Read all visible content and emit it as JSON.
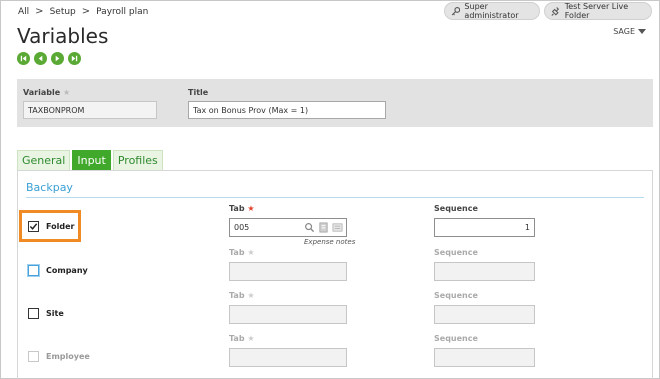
{
  "breadcrumb": {
    "items": [
      "All",
      "Setup",
      "Payroll plan"
    ],
    "separator": ">"
  },
  "top_buttons": {
    "user": {
      "label": "Super administrator",
      "icon": "key-icon"
    },
    "folder": {
      "label": "Test Server Live Folder",
      "icon": "plug-icon"
    }
  },
  "page": {
    "title": "Variables",
    "company_selector": "SAGE"
  },
  "record_nav": [
    "first-record-icon",
    "previous-record-icon",
    "next-record-icon",
    "last-record-icon"
  ],
  "header": {
    "variable": {
      "label": "Variable",
      "value": "TAXBONPROM"
    },
    "title": {
      "label": "Title",
      "value": "Tax on Bonus Prov (Max = 1)"
    }
  },
  "tabs": [
    {
      "label": "General",
      "active": false
    },
    {
      "label": "Input",
      "active": true
    },
    {
      "label": "Profiles",
      "active": false
    }
  ],
  "section": {
    "title": "Backpay",
    "rows": [
      {
        "checkbox": "Folder",
        "checked": true,
        "tab_label": "Tab",
        "tab_value": "005",
        "tab_hint": "Expense notes",
        "sequence_label": "Sequence",
        "sequence_value": "1"
      },
      {
        "checkbox": "Company",
        "checked": false,
        "tab_label": "Tab",
        "tab_value": "",
        "sequence_label": "Sequence",
        "sequence_value": ""
      },
      {
        "checkbox": "Site",
        "checked": false,
        "tab_label": "Tab",
        "tab_value": "",
        "sequence_label": "Sequence",
        "sequence_value": ""
      },
      {
        "checkbox": "Employee",
        "checked": false,
        "tab_label": "Tab",
        "tab_value": "",
        "sequence_label": "Sequence",
        "sequence_value": ""
      }
    ]
  },
  "colors": {
    "accent_green": "#40a82a",
    "section_blue": "#3aa0d5",
    "highlight_orange": "#f08a24",
    "required_red": "#e0442c"
  }
}
